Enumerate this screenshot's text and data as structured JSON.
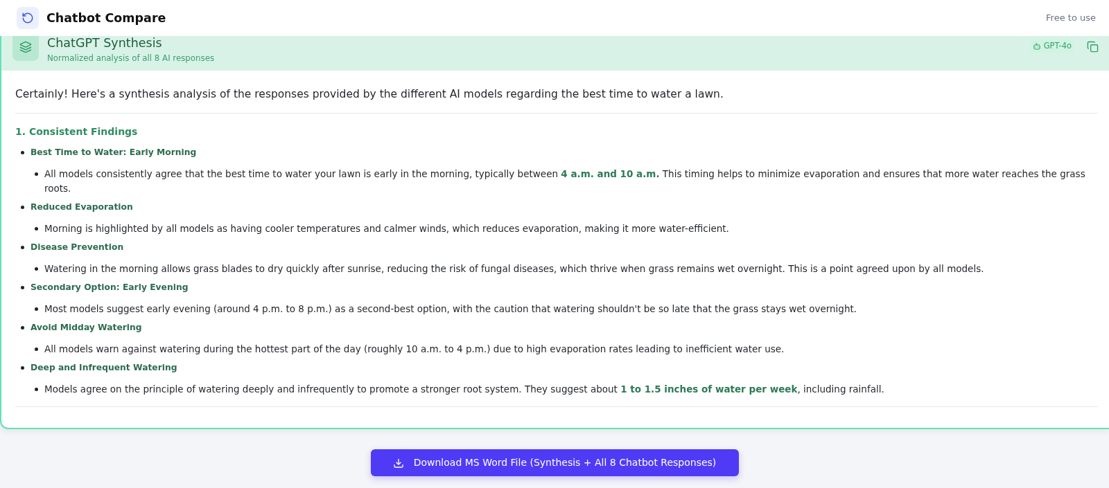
{
  "header": {
    "title": "Chatbot Compare",
    "tagline": "Free to use"
  },
  "synthesis": {
    "title": "ChatGPT Synthesis",
    "subtitle": "Normalized analysis of all 8 AI responses",
    "model": "GPT-4o",
    "intro": "Certainly! Here's a synthesis analysis of the responses provided by the different AI models regarding the best time to water a lawn.",
    "sections": [
      {
        "heading": "1. Consistent Findings",
        "items": [
          {
            "title": "Best Time to Water: Early Morning",
            "points": [
              "All models consistently agree that the best time to water your lawn is early in the morning, typically between **4 a.m. and 10 a.m.** This timing helps to minimize evaporation and ensures that more water reaches the grass roots."
            ]
          },
          {
            "title": "Reduced Evaporation",
            "points": [
              "Morning is highlighted by all models as having cooler temperatures and calmer winds, which reduces evaporation, making it more water-efficient."
            ]
          },
          {
            "title": "Disease Prevention",
            "points": [
              "Watering in the morning allows grass blades to dry quickly after sunrise, reducing the risk of fungal diseases, which thrive when grass remains wet overnight. This is a point agreed upon by all models."
            ]
          },
          {
            "title": "Secondary Option: Early Evening",
            "points": [
              "Most models suggest early evening (around 4 p.m. to 8 p.m.) as a second-best option, with the caution that watering shouldn't be so late that the grass stays wet overnight."
            ]
          },
          {
            "title": "Avoid Midday Watering",
            "points": [
              "All models warn against watering during the hottest part of the day (roughly 10 a.m. to 4 p.m.) due to high evaporation rates leading to inefficient water use."
            ]
          },
          {
            "title": "Deep and Infrequent Watering",
            "points": [
              "Models agree on the principle of watering deeply and infrequently to promote a stronger root system. They suggest about **1 to 1.5 inches of water per week**, including rainfall."
            ]
          }
        ]
      }
    ]
  },
  "download_button": {
    "label": "Download MS Word File (Synthesis + All 8 Chatbot Responses)"
  }
}
